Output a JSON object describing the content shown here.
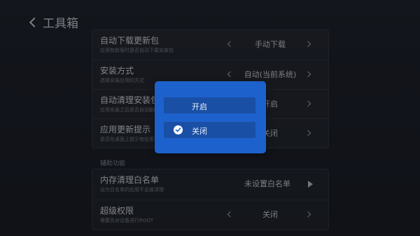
{
  "header": {
    "title": "工具箱"
  },
  "group1": {
    "rows": [
      {
        "title": "自动下载更新包",
        "sub": "应用有新版时是否自动下载安装包",
        "value": "手动下载"
      },
      {
        "title": "安装方式",
        "sub": "选择安装应用的方式",
        "value": "自动(当前系统)"
      },
      {
        "title": "自动清理安装包",
        "sub": "应用安装之后是否自动删除安装包",
        "value": "开启"
      },
      {
        "title": "应用更新提示",
        "sub": "是否在桌面上提示有应用更新",
        "value": "关闭"
      }
    ]
  },
  "section": {
    "label": "辅助功能"
  },
  "group2": {
    "rows": [
      {
        "title": "内存清理白名单",
        "sub": "设为白名单的应用不会被清理",
        "value": "未设置白名单"
      },
      {
        "title": "超级权限",
        "sub": "需要先对设备进行ROOT",
        "value": "关闭"
      }
    ]
  },
  "dialog": {
    "options": [
      {
        "label": "开启",
        "selected": false
      },
      {
        "label": "关闭",
        "selected": true
      }
    ]
  },
  "colors": {
    "dialog_bg": "#1d62cc",
    "option_bg": "#1a4fa6",
    "background": "#161b22"
  }
}
